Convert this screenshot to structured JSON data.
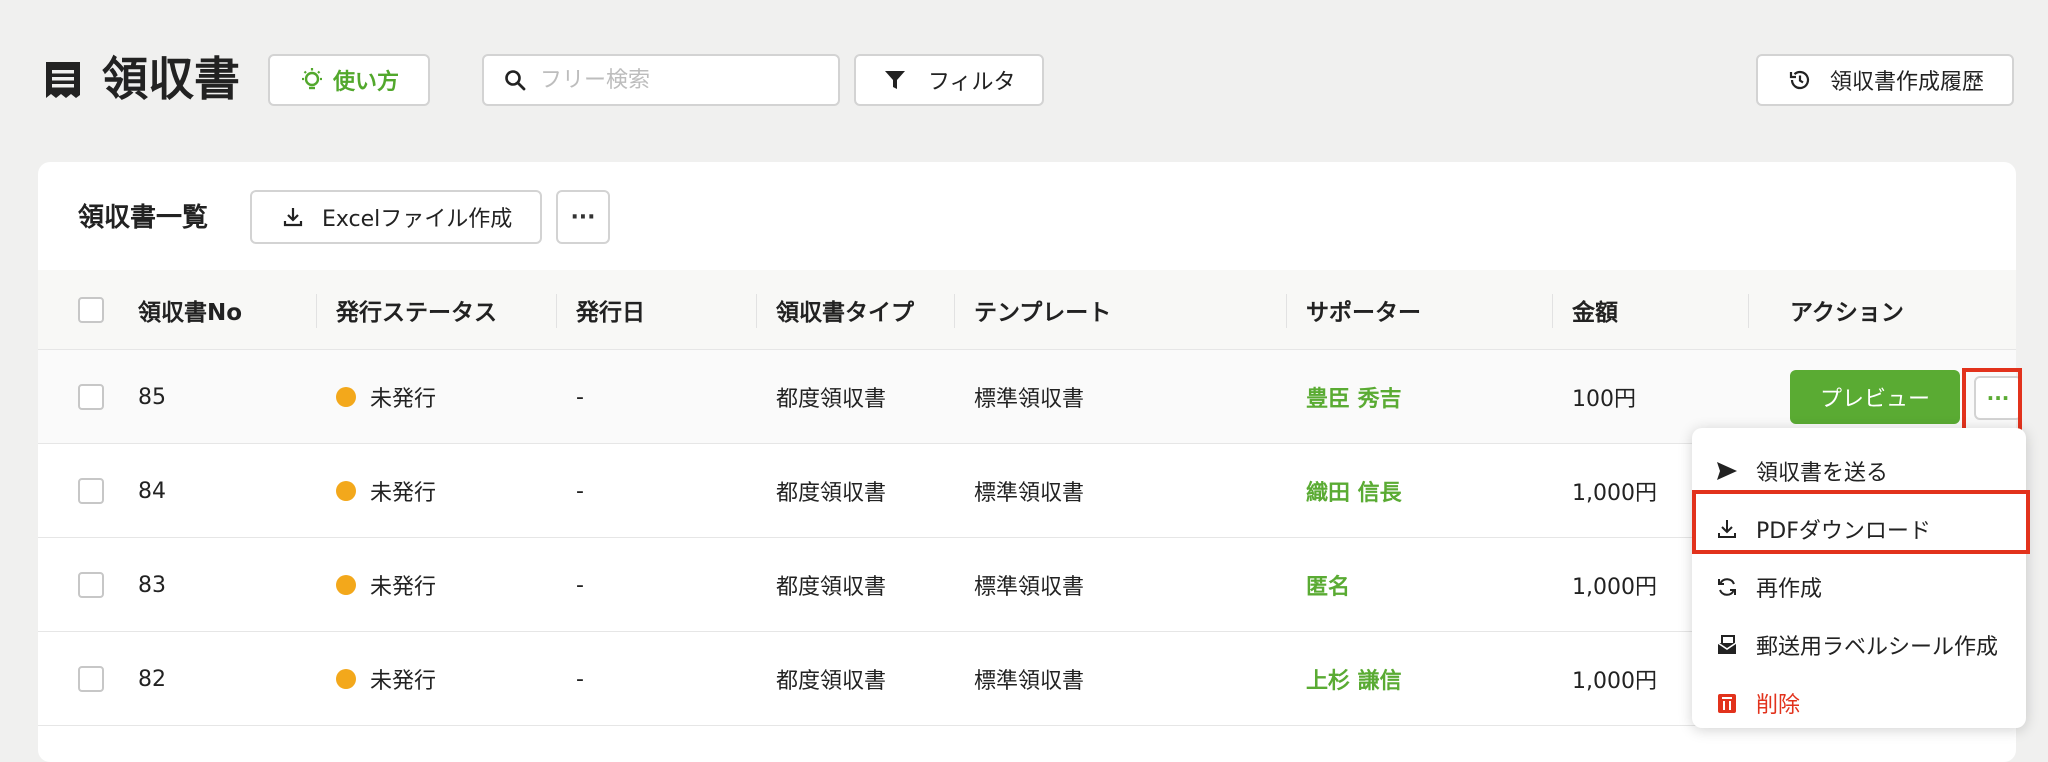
{
  "header": {
    "title": "領収書",
    "howto_label": "使い方",
    "search_placeholder": "フリー検索",
    "filter_label": "フィルタ",
    "history_label": "領収書作成履歴"
  },
  "card": {
    "title": "領収書一覧",
    "excel_label": "Excelファイル作成",
    "more_label": "···"
  },
  "table": {
    "columns": [
      "領収書No",
      "発行ステータス",
      "発行日",
      "領収書タイプ",
      "テンプレート",
      "サポーター",
      "金額",
      "アクション"
    ],
    "rows": [
      {
        "no": "85",
        "status": "未発行",
        "date": "-",
        "type": "都度領収書",
        "template": "標準領収書",
        "supporter": "豊臣 秀吉",
        "amount": "100円"
      },
      {
        "no": "84",
        "status": "未発行",
        "date": "-",
        "type": "都度領収書",
        "template": "標準領収書",
        "supporter": "織田 信長",
        "amount": "1,000円"
      },
      {
        "no": "83",
        "status": "未発行",
        "date": "-",
        "type": "都度領収書",
        "template": "標準領収書",
        "supporter": "匿名",
        "amount": "1,000円"
      },
      {
        "no": "82",
        "status": "未発行",
        "date": "-",
        "type": "都度領収書",
        "template": "標準領収書",
        "supporter": "上杉 謙信",
        "amount": "1,000円"
      }
    ],
    "preview_label": "プレビュー",
    "row_more_label": "···"
  },
  "menu": {
    "items": [
      {
        "label": "領収書を送る",
        "icon": "send-icon"
      },
      {
        "label": "PDFダウンロード",
        "icon": "download-icon"
      },
      {
        "label": "再作成",
        "icon": "refresh-icon"
      },
      {
        "label": "郵送用ラベルシール作成",
        "icon": "label-print-icon"
      },
      {
        "label": "削除",
        "icon": "trash-icon"
      }
    ]
  },
  "colors": {
    "accent_green": "#5aab33",
    "status_pending": "#f3a81b",
    "danger": "#e2321c",
    "highlight": "#e2321c"
  }
}
